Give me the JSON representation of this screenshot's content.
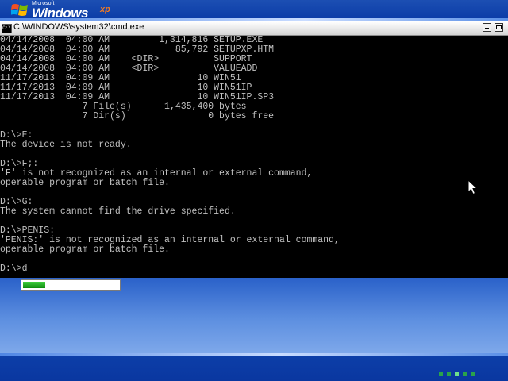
{
  "logo": {
    "ms": "Microsoft",
    "windows": "Windows",
    "xp": "xp"
  },
  "cmd": {
    "title": "C:\\WINDOWS\\system32\\cmd.exe",
    "icon_text": "C:\\",
    "lines": [
      "04/14/2008  04:00 AM         1,314,816 SETUP.EXE",
      "04/14/2008  04:00 AM            85,792 SETUPXP.HTM",
      "04/14/2008  04:00 AM    <DIR>          SUPPORT",
      "04/14/2008  04:00 AM    <DIR>          VALUEADD",
      "11/17/2013  04:09 AM                10 WIN51",
      "11/17/2013  04:09 AM                10 WIN51IP",
      "11/17/2013  04:09 AM                10 WIN51IP.SP3",
      "               7 File(s)      1,435,400 bytes",
      "               7 Dir(s)               0 bytes free",
      "",
      "D:\\>E:",
      "The device is not ready.",
      "",
      "D:\\>F;:",
      "'F' is not recognized as an internal or external command,",
      "operable program or batch file.",
      "",
      "D:\\>G:",
      "The system cannot find the drive specified.",
      "",
      "D:\\>PENIS:",
      "'PENIS:' is not recognized as an internal or external command,",
      "operable program or batch file.",
      "",
      "D:\\>d"
    ]
  },
  "setup_progress": {
    "value_percent": 23
  },
  "icons": [
    "windows-flag-icon",
    "cmd-icon",
    "minimize-icon",
    "maximize-icon",
    "mouse-pointer-icon"
  ],
  "colors": {
    "setup_blue": "#0a3aa6",
    "console_text": "#c0c0c0",
    "progress_green": "#1ea61e"
  }
}
